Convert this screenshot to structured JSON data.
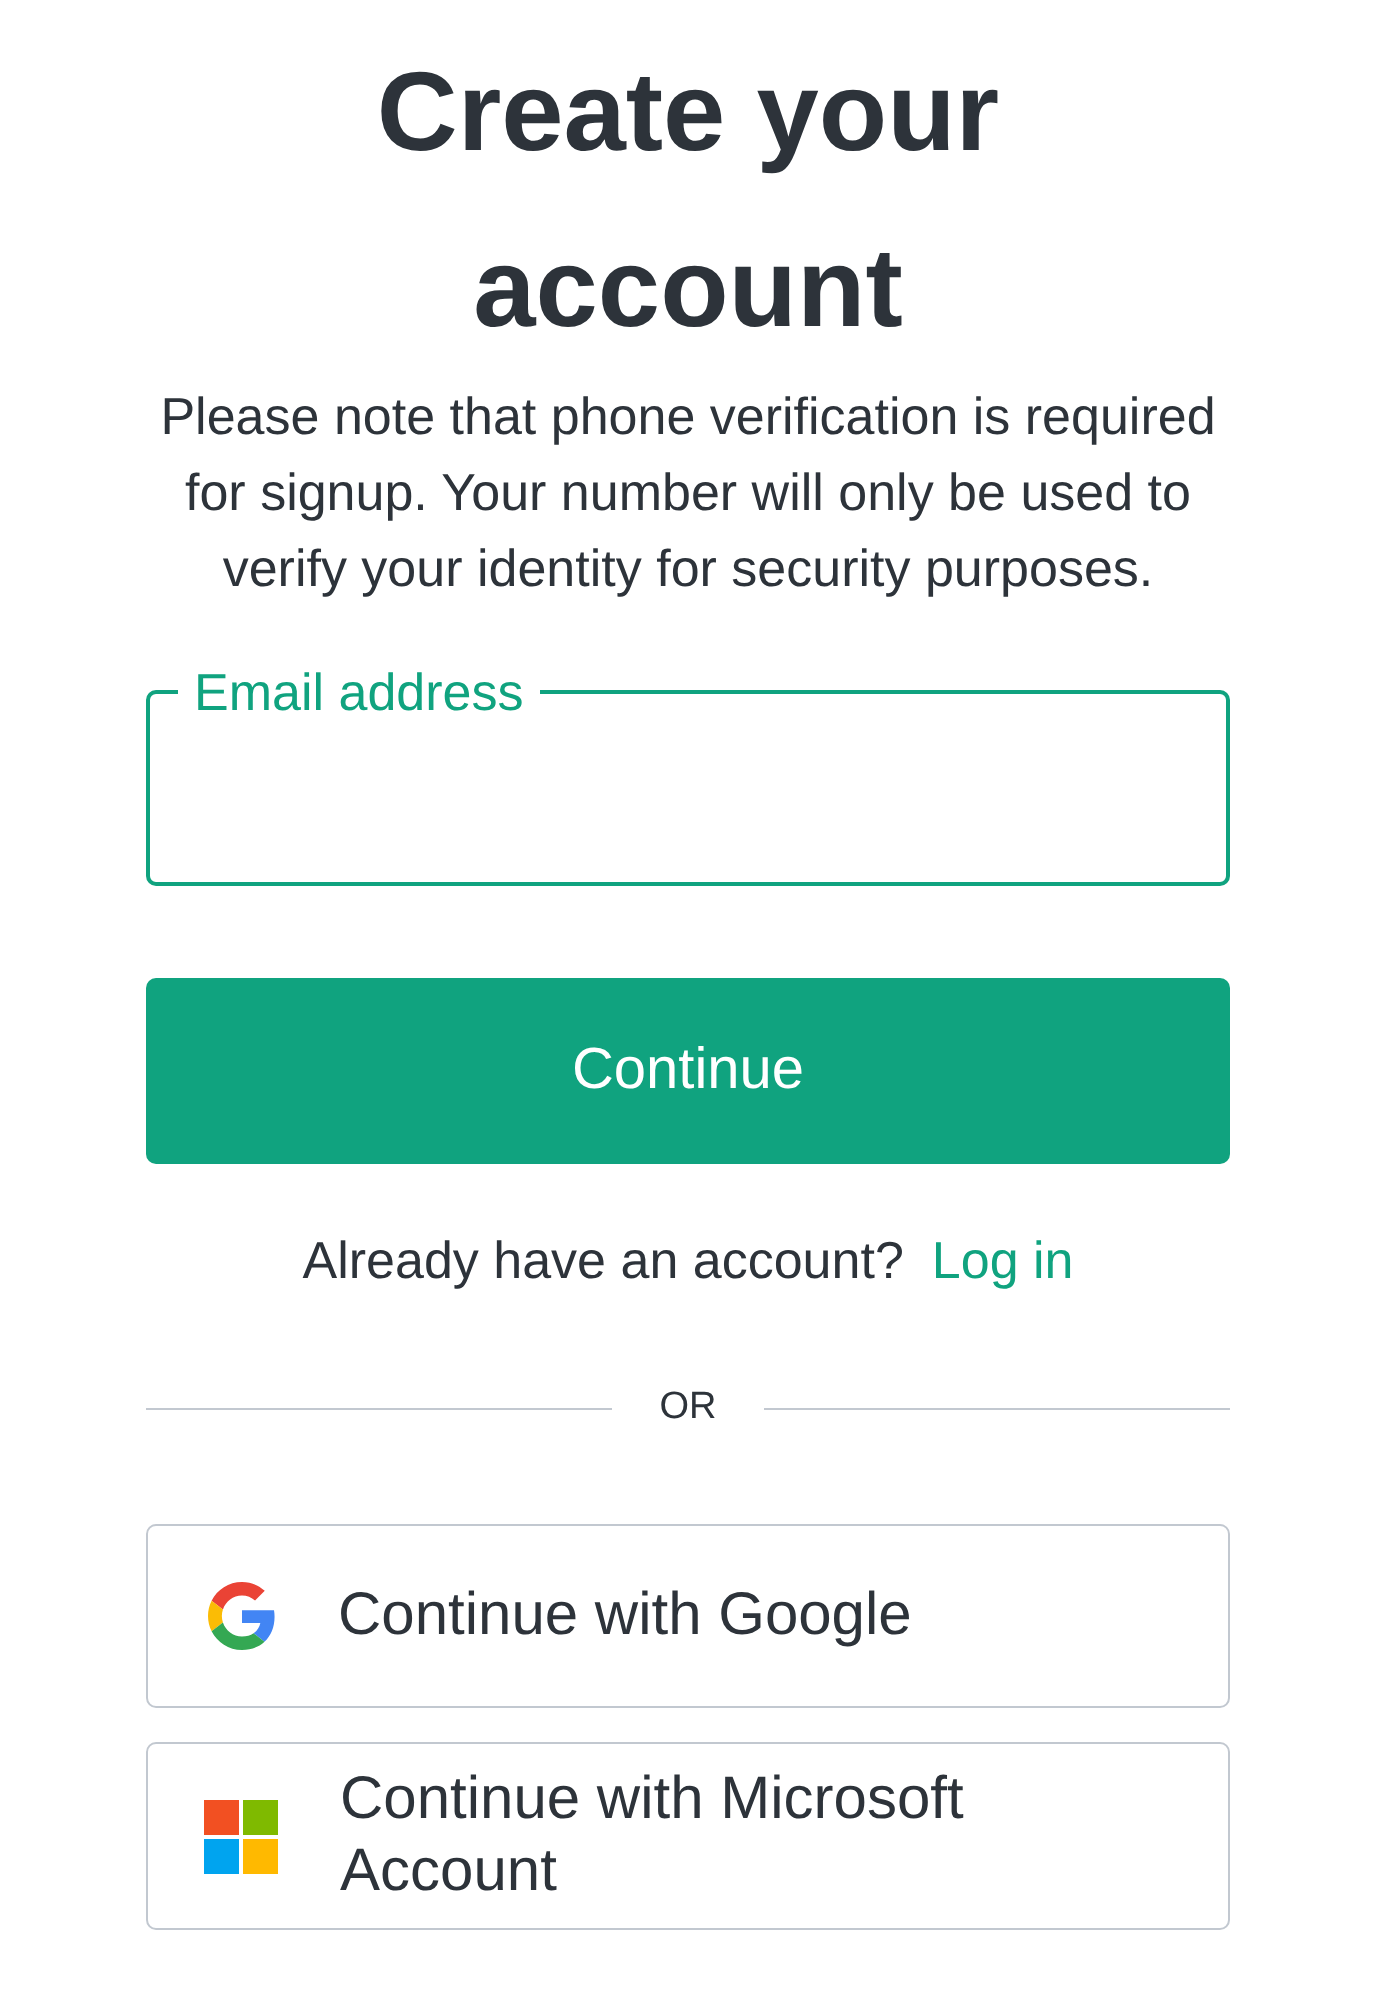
{
  "title": "Create your account",
  "notice": "Please note that phone verification is required for signup. Your number will only be used to verify your identity for security purposes.",
  "email_field": {
    "label": "Email address"
  },
  "continue_button": "Continue",
  "login_prompt": {
    "text": "Already have an account?",
    "link": "Log in"
  },
  "divider": "OR",
  "social_buttons": [
    {
      "kind": "google",
      "label": "Continue with Google"
    },
    {
      "kind": "microsoft",
      "label": "Continue with Microsoft Account"
    }
  ]
}
